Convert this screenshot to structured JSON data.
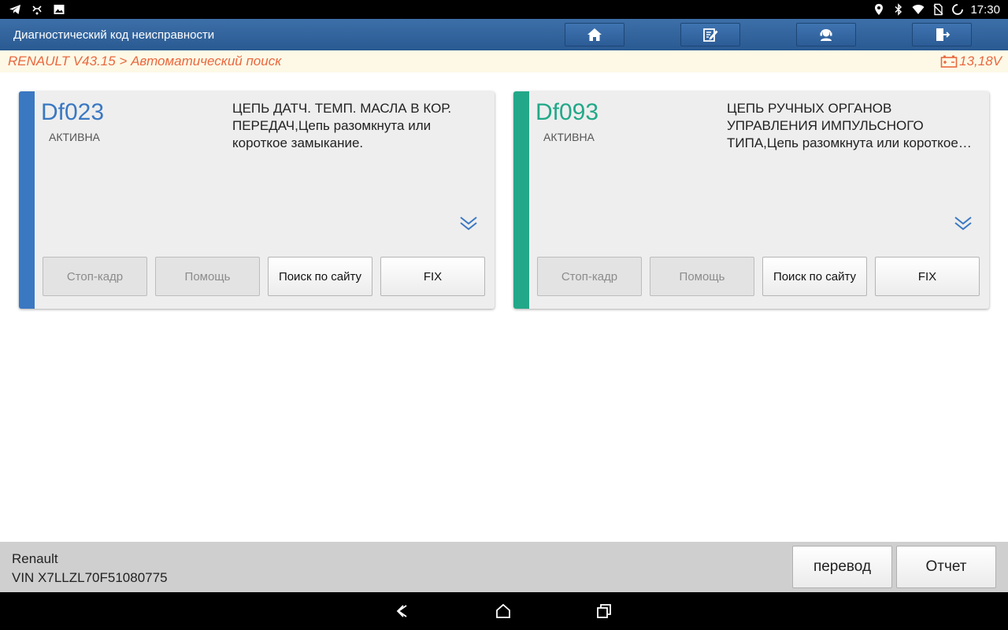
{
  "statusbar": {
    "left_icons": [
      "telegram-icon",
      "usb-debug-icon",
      "image-icon"
    ],
    "right_icons": [
      "location-icon",
      "bluetooth-icon",
      "wifi-icon",
      "no-sim-icon",
      "sync-icon"
    ],
    "time": "17:30"
  },
  "header": {
    "title": "Диагностический код неисправности",
    "buttons": [
      "home-icon",
      "edit-report-icon",
      "support-icon",
      "exit-icon"
    ]
  },
  "breadcrumb": {
    "path": "RENAULT V43.15 > Автоматический поиск",
    "voltage": "13,18V"
  },
  "colors": {
    "header": "#2f5f99",
    "accent_orange": "#e9683f",
    "card1_bar": "#3a78c2",
    "card2_bar": "#22a889"
  },
  "faults": [
    {
      "code": "Df023",
      "status": "АКТИВНА",
      "description": "ЦЕПЬ ДАТЧ. ТЕМП. МАСЛА В КОР. ПЕРЕДАЧ,Цепь разомкнута или короткое замыкание.",
      "buttons": [
        "Стоп-кадр",
        "Помощь",
        "Поиск по сайту",
        "FIX"
      ]
    },
    {
      "code": "Df093",
      "status": "АКТИВНА",
      "description": "ЦЕПЬ РУЧНЫХ ОРГАНОВ УПРАВЛЕНИЯ ИМПУЛЬСНОГО ТИПА,Цепь разомкнута или короткое замыкание.",
      "buttons": [
        "Стоп-кадр",
        "Помощь",
        "Поиск по сайту",
        "FIX"
      ]
    }
  ],
  "footer": {
    "make": "Renault",
    "vin": "VIN X7LLZL70F51080775",
    "translate_label": "перевод",
    "report_label": "Отчет"
  },
  "navbar": [
    "back-icon",
    "home-nav-icon",
    "recents-icon"
  ]
}
